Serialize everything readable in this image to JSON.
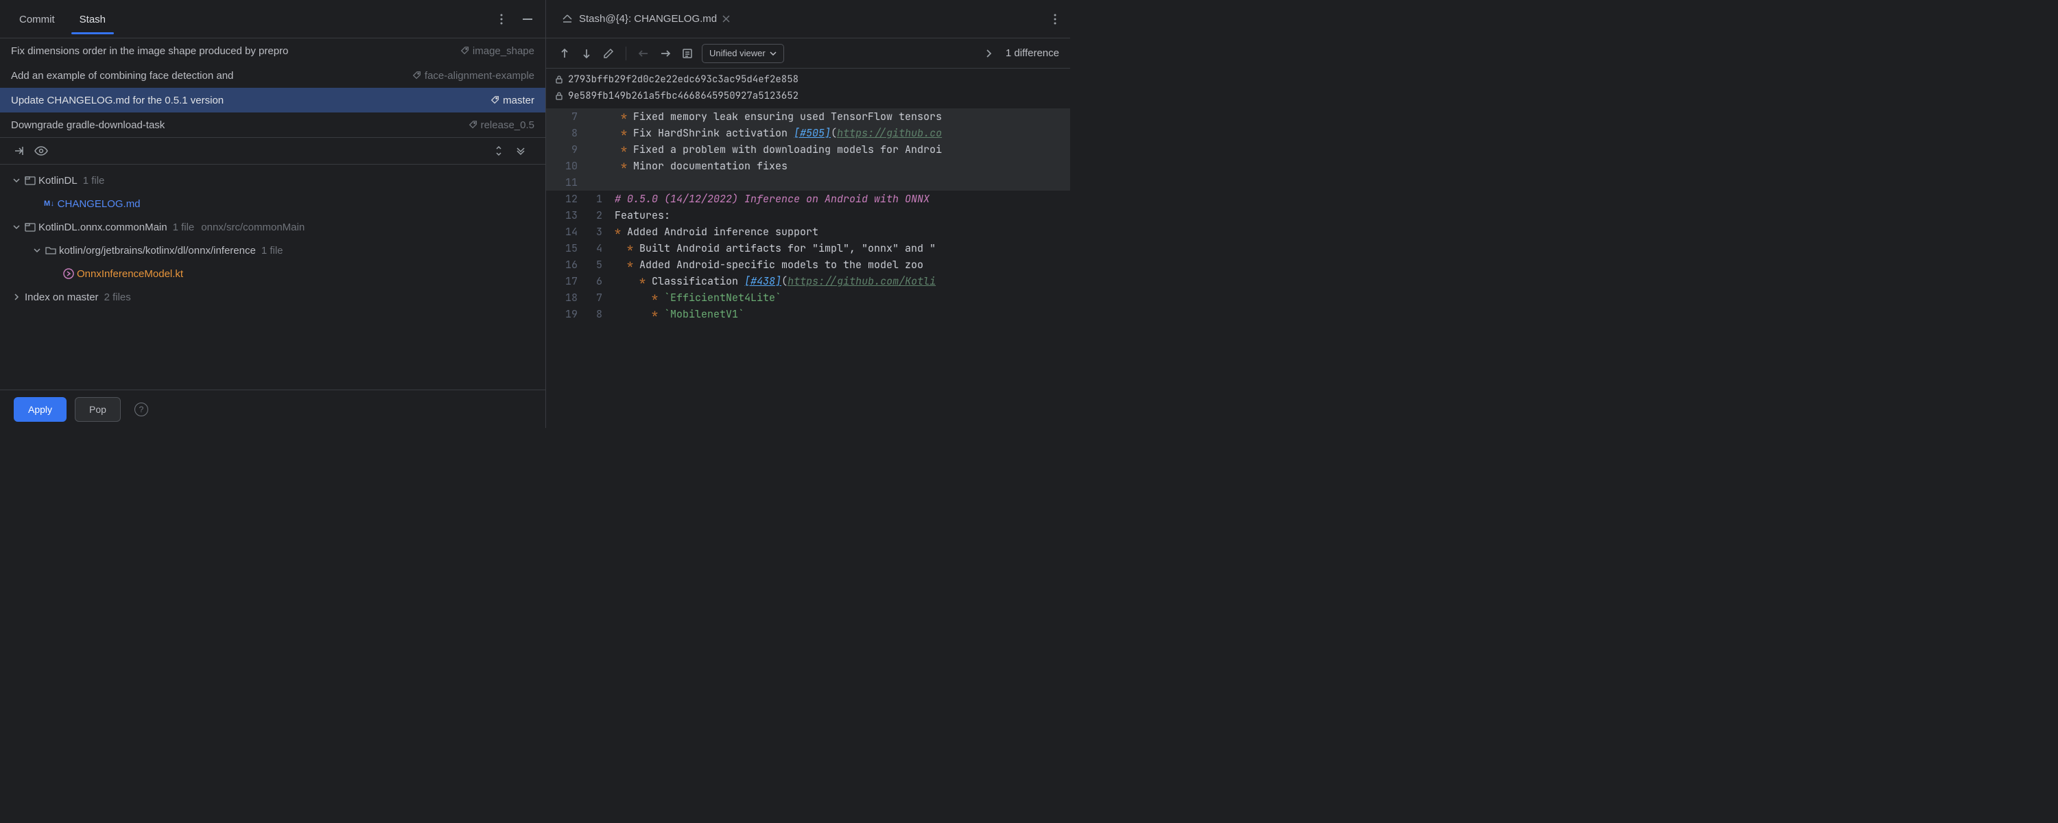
{
  "tabs": {
    "commit": "Commit",
    "stash": "Stash"
  },
  "stashes": [
    {
      "msg": "Fix dimensions order in the image shape produced by prepro",
      "branch": "image_shape"
    },
    {
      "msg": "Add an example of combining face detection and ",
      "branch": "face-alignment-example"
    },
    {
      "msg": "Update CHANGELOG.md for the 0.5.1 version",
      "branch": "master"
    },
    {
      "msg": "Downgrade gradle-download-task",
      "branch": "release_0.5"
    }
  ],
  "tree": {
    "root1": {
      "label": "KotlinDL",
      "count": "1 file"
    },
    "file1": {
      "badge": "M↓",
      "name": "CHANGELOG.md"
    },
    "root2": {
      "label": "KotlinDL.onnx.commonMain",
      "count": "1 file",
      "path": "onnx/src/commonMain"
    },
    "sub2": {
      "label": "kotlin/org/jetbrains/kotlinx/dl/onnx/inference",
      "count": "1 file"
    },
    "file2": {
      "name": "OnnxInferenceModel.kt"
    },
    "root3": {
      "label": "Index on master",
      "count": "2 files"
    }
  },
  "footer": {
    "apply": "Apply",
    "pop": "Pop"
  },
  "editor": {
    "tab_prefix_icon": "stash",
    "tab_title": "Stash@{4}: CHANGELOG.md",
    "viewer_label": "Unified viewer",
    "diff_count": "1 difference",
    "hash1": "2793bffb29f2d0c2e22edc693c3ac95d4ef2e858",
    "hash2": "9e589fb149b261a5fbc4668645950927a5123652"
  },
  "code_lines": [
    {
      "l": "7",
      "r": "",
      "dim": true,
      "segs": [
        [
          " * ",
          "tok-star"
        ],
        [
          "Fixed memory leak ensuring used TensorFlow tensors",
          ""
        ]
      ]
    },
    {
      "l": "8",
      "r": "",
      "dim": true,
      "segs": [
        [
          " * ",
          "tok-star"
        ],
        [
          "Fix HardShrink activation ",
          ""
        ],
        [
          "[#505]",
          "tok-link"
        ],
        [
          "(",
          "tok-paren"
        ],
        [
          "https://github.co",
          "tok-url"
        ]
      ]
    },
    {
      "l": "9",
      "r": "",
      "dim": true,
      "segs": [
        [
          " * ",
          "tok-star"
        ],
        [
          "Fixed a problem with downloading models for Androi",
          ""
        ]
      ]
    },
    {
      "l": "10",
      "r": "",
      "dim": true,
      "segs": [
        [
          " * ",
          "tok-star"
        ],
        [
          "Minor documentation fixes",
          ""
        ]
      ]
    },
    {
      "l": "11",
      "r": "",
      "dim": true,
      "segs": [
        [
          "",
          ""
        ]
      ]
    },
    {
      "l": "12",
      "r": "1",
      "dim": false,
      "segs": [
        [
          "# 0.5.0 (14/12/2022) Inference on Android with ONNX",
          "tok-heading"
        ]
      ]
    },
    {
      "l": "13",
      "r": "2",
      "dim": false,
      "segs": [
        [
          "Features:",
          ""
        ]
      ]
    },
    {
      "l": "14",
      "r": "3",
      "dim": false,
      "segs": [
        [
          "* ",
          "tok-star"
        ],
        [
          "Added Android inference support",
          ""
        ]
      ]
    },
    {
      "l": "15",
      "r": "4",
      "dim": false,
      "segs": [
        [
          "  * ",
          "tok-star"
        ],
        [
          "Built Android artifacts for \"impl\", \"onnx\" and \"",
          ""
        ]
      ]
    },
    {
      "l": "16",
      "r": "5",
      "dim": false,
      "segs": [
        [
          "  * ",
          "tok-star"
        ],
        [
          "Added Android-specific models to the model zoo",
          ""
        ]
      ]
    },
    {
      "l": "17",
      "r": "6",
      "dim": false,
      "segs": [
        [
          "    * ",
          "tok-star"
        ],
        [
          "Classification ",
          ""
        ],
        [
          "[#438]",
          "tok-link"
        ],
        [
          "(",
          "tok-paren"
        ],
        [
          "https://github.com/Kotli",
          "tok-url"
        ]
      ]
    },
    {
      "l": "18",
      "r": "7",
      "dim": false,
      "segs": [
        [
          "      * ",
          "tok-star"
        ],
        [
          "`EfficientNet4Lite`",
          "tok-code"
        ]
      ]
    },
    {
      "l": "19",
      "r": "8",
      "dim": false,
      "segs": [
        [
          "      * ",
          "tok-star"
        ],
        [
          "`MobilenetV1`",
          "tok-code"
        ]
      ]
    }
  ]
}
